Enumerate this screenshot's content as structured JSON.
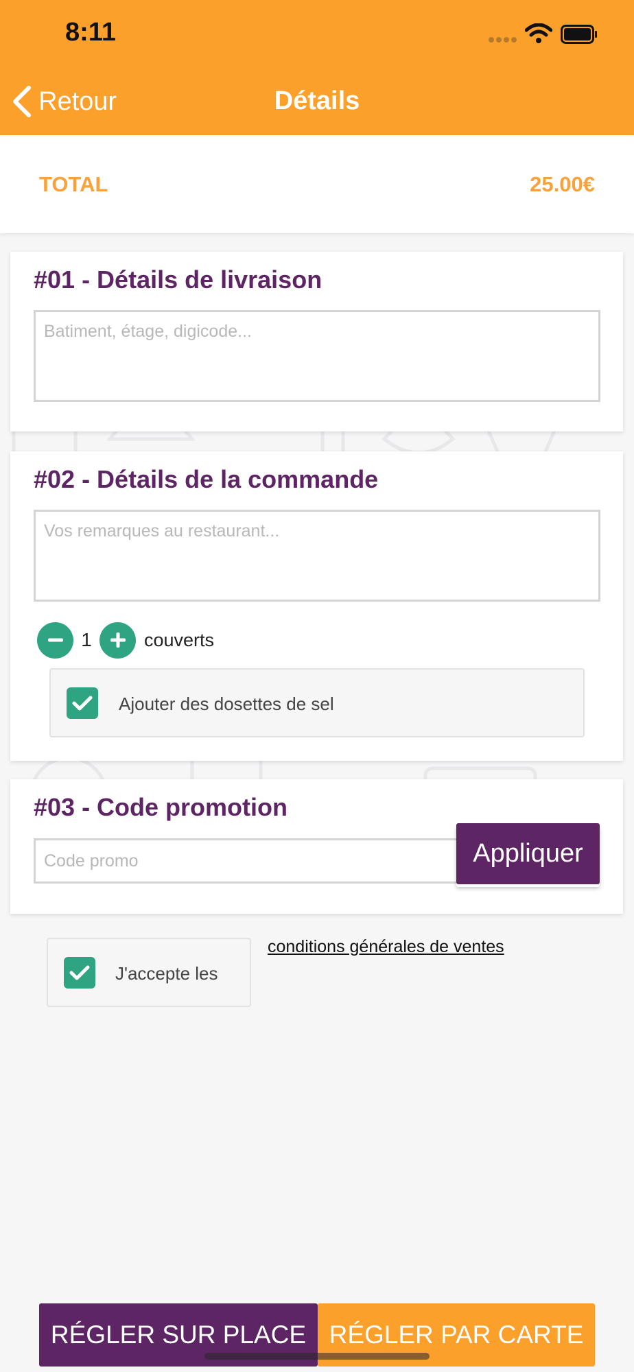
{
  "status_bar": {
    "time": "8:11"
  },
  "nav": {
    "back_label": "Retour",
    "title": "Détails"
  },
  "total": {
    "label": "TOTAL",
    "value": "25.00€"
  },
  "delivery": {
    "title": "#01 - Détails de livraison",
    "placeholder": "Batiment, étage, digicode..."
  },
  "order": {
    "title": "#02 - Détails de la commande",
    "placeholder": "Vos remarques au restaurant...",
    "covers_count": "1",
    "covers_label": "couverts",
    "salt_option": {
      "label": "Ajouter des dosettes de sel",
      "checked": true
    }
  },
  "promo": {
    "title": "#03 - Code promotion",
    "placeholder": "Code promo",
    "apply_label": "Appliquer"
  },
  "terms": {
    "accept_label": "J'accepte les",
    "link_label": "conditions générales de ventes",
    "checked": true
  },
  "actions": {
    "pay_on_site": "RÉGLER SUR PLACE",
    "pay_by_card": "RÉGLER PAR CARTE"
  },
  "colors": {
    "brand_orange": "#fca02c",
    "brand_purple": "#5e2564",
    "accent_green": "#2fa483",
    "total_orange": "#f7a23a"
  }
}
